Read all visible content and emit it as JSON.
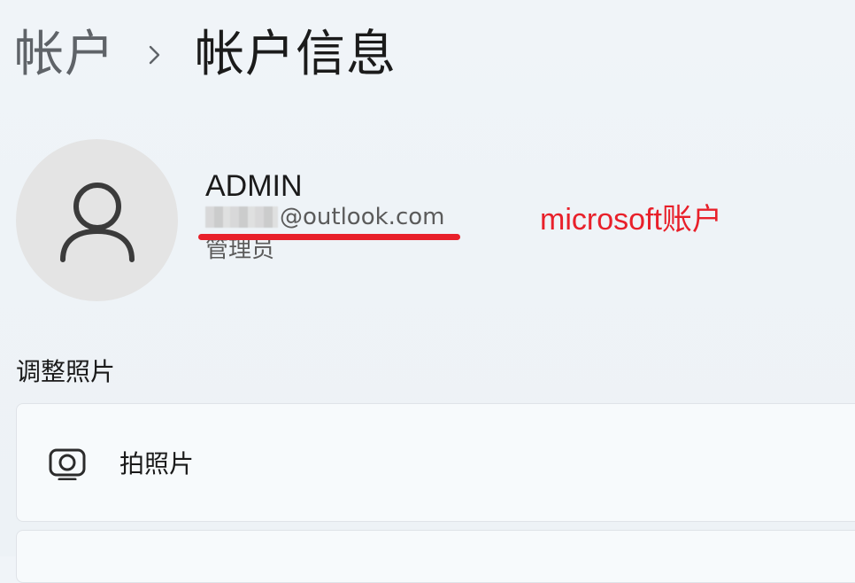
{
  "breadcrumb": {
    "parent": "帐户",
    "current": "帐户信息"
  },
  "account": {
    "name": "ADMIN",
    "email_domain": "@outlook.com",
    "role": "管理员"
  },
  "annotation": {
    "text": "microsoft账户",
    "color": "#e8202a"
  },
  "photo_section": {
    "title": "调整照片",
    "items": [
      {
        "label": "拍照片",
        "icon": "camera-icon"
      }
    ]
  },
  "colors": {
    "accent_red": "#e8202a",
    "avatar_bg": "#e4e4e4"
  }
}
